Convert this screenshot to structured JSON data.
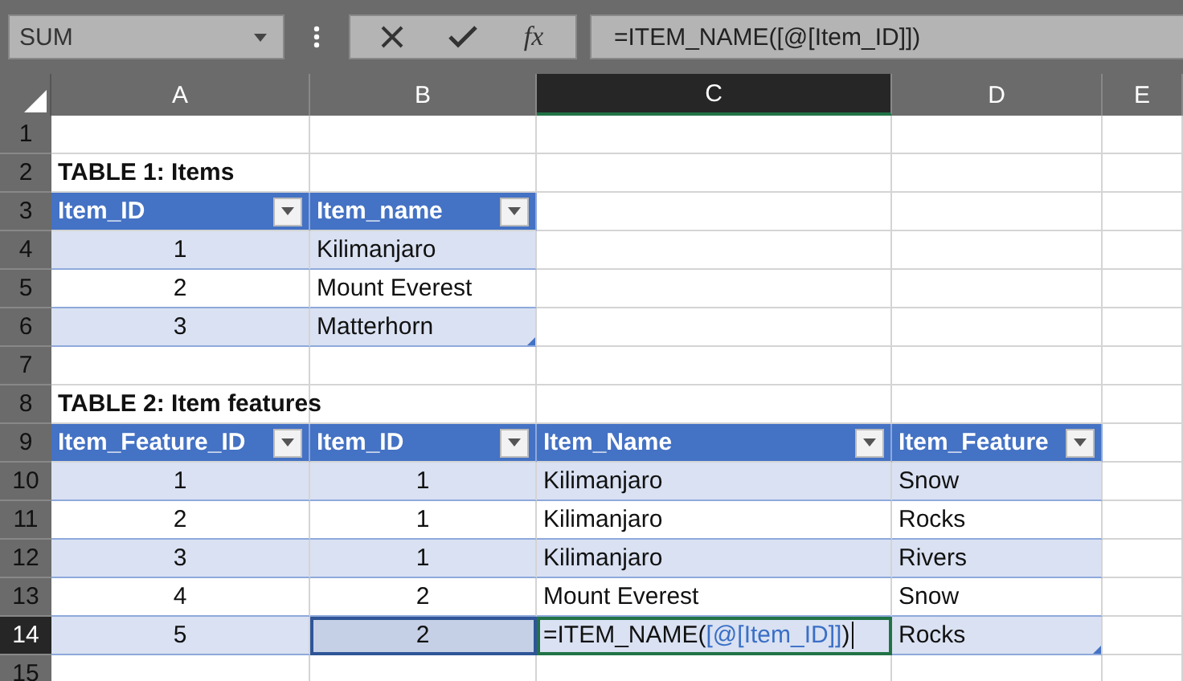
{
  "formula_bar": {
    "name_box": "SUM",
    "function_button": "fx",
    "formula": "=ITEM_NAME([@[Item_ID]])"
  },
  "column_headers": [
    {
      "label": "A",
      "selected": false
    },
    {
      "label": "B",
      "selected": false
    },
    {
      "label": "C",
      "selected": true
    },
    {
      "label": "D",
      "selected": false
    },
    {
      "label": "E",
      "selected": false
    }
  ],
  "row_headers": [
    {
      "label": "1",
      "selected": false
    },
    {
      "label": "2",
      "selected": false
    },
    {
      "label": "3",
      "selected": false
    },
    {
      "label": "4",
      "selected": false
    },
    {
      "label": "5",
      "selected": false
    },
    {
      "label": "6",
      "selected": false
    },
    {
      "label": "7",
      "selected": false
    },
    {
      "label": "8",
      "selected": false
    },
    {
      "label": "9",
      "selected": false
    },
    {
      "label": "10",
      "selected": false
    },
    {
      "label": "11",
      "selected": false
    },
    {
      "label": "12",
      "selected": false
    },
    {
      "label": "13",
      "selected": false
    },
    {
      "label": "14",
      "selected": true
    },
    {
      "label": "15",
      "selected": false
    }
  ],
  "tables": [
    {
      "title": "TABLE 1: Items",
      "columns": [
        {
          "name": "Item_ID",
          "kind": "number"
        },
        {
          "name": "Item_name",
          "kind": "text"
        }
      ],
      "rows": [
        [
          {
            "text": "1"
          },
          {
            "text": "Kilimanjaro"
          }
        ],
        [
          {
            "text": "2"
          },
          {
            "text": "Mount Everest"
          }
        ],
        [
          {
            "text": "3"
          },
          {
            "text": "Matterhorn"
          }
        ]
      ]
    },
    {
      "title": "TABLE 2: Item features",
      "columns": [
        {
          "name": "Item_Feature_ID",
          "kind": "number"
        },
        {
          "name": "Item_ID",
          "kind": "number"
        },
        {
          "name": "Item_Name",
          "kind": "text"
        },
        {
          "name": "Item_Feature",
          "kind": "text"
        }
      ],
      "rows": [
        [
          {
            "text": "1"
          },
          {
            "text": "1"
          },
          {
            "text": "Kilimanjaro"
          },
          {
            "text": "Snow"
          }
        ],
        [
          {
            "text": "2"
          },
          {
            "text": "1"
          },
          {
            "text": "Kilimanjaro"
          },
          {
            "text": "Rocks"
          }
        ],
        [
          {
            "text": "3"
          },
          {
            "text": "1"
          },
          {
            "text": "Kilimanjaro"
          },
          {
            "text": "Rivers"
          }
        ],
        [
          {
            "text": "4"
          },
          {
            "text": "2"
          },
          {
            "text": "Mount Everest"
          },
          {
            "text": "Snow"
          }
        ],
        [
          {
            "text": "5"
          },
          {
            "text": "2",
            "referenced": true
          },
          {
            "editing": true,
            "parts": [
              {
                "text": "=ITEM_NAME(",
                "kind": "plain"
              },
              {
                "text": "[@[Item_ID]]",
                "kind": "reference"
              },
              {
                "text": ")",
                "kind": "plain"
              }
            ]
          },
          {
            "text": "Rocks"
          }
        ]
      ]
    }
  ]
}
